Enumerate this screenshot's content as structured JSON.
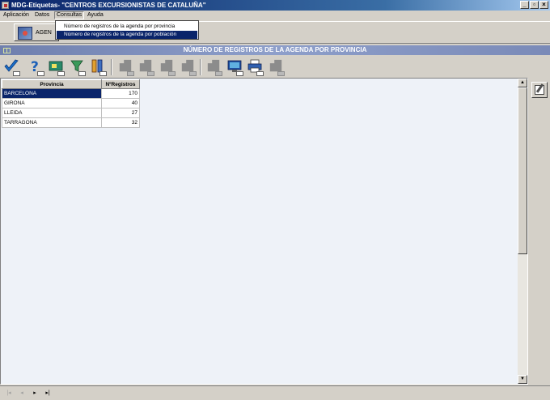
{
  "window": {
    "title": "MDG-Etiquetas- \"CENTROS EXCURSIONISTAS DE CATALUÑA\"",
    "controls": {
      "minimize": "_",
      "maximize": "▫",
      "close": "×"
    }
  },
  "menu": {
    "items": [
      {
        "label": "Aplicación"
      },
      {
        "label": "Datos"
      },
      {
        "label": "Consultas"
      },
      {
        "label": "Ayuda"
      }
    ],
    "open_menu": "Consultas",
    "dropdown": [
      {
        "label": "Número de registros de la agenda por provincia",
        "selected": false
      },
      {
        "label": "Número de registros de la agenda por población",
        "selected": true
      }
    ]
  },
  "module": {
    "label": "AGEN"
  },
  "view": {
    "title": "NÚMERO DE REGISTROS DE LA AGENDA POR PROVINCIA"
  },
  "toolbar": {
    "buttons": [
      {
        "icon": "checkmark-icon",
        "enabled": true
      },
      {
        "icon": "help-question-icon",
        "enabled": true
      },
      {
        "icon": "card-image-icon",
        "enabled": true
      },
      {
        "icon": "filter-funnel-icon",
        "enabled": true
      },
      {
        "icon": "columns-grid-icon",
        "enabled": true
      },
      {
        "icon": "record-icon",
        "enabled": false
      },
      {
        "icon": "record-edit-icon",
        "enabled": false
      },
      {
        "icon": "record-copy-icon",
        "enabled": false
      },
      {
        "icon": "record-delete-icon",
        "enabled": false
      },
      {
        "icon": "record-export-icon",
        "enabled": false
      },
      {
        "icon": "screen-preview-icon",
        "enabled": true
      },
      {
        "icon": "printer-icon",
        "enabled": true
      },
      {
        "icon": "record-extra-icon",
        "enabled": false
      }
    ]
  },
  "table": {
    "columns": [
      "Provincia",
      "NºRegistros"
    ],
    "rows": [
      {
        "provincia": "BARCELONA",
        "registros": "170",
        "selected": true
      },
      {
        "provincia": "GIRONA",
        "registros": "40",
        "selected": false
      },
      {
        "provincia": "LLEIDA",
        "registros": "27",
        "selected": false
      },
      {
        "provincia": "TARRAGONA",
        "registros": "32",
        "selected": false
      }
    ]
  },
  "scrollbar": {
    "up": "▲",
    "down": "▼"
  },
  "navigation": {
    "first": "|◂",
    "prev": "◂",
    "next": "▸",
    "last": "▸|"
  },
  "colors": {
    "selection": "#0a246a",
    "titlebar": "#0a246a",
    "panel_bg": "#eef2f8",
    "view_title_bg": "#7a8ab8"
  }
}
